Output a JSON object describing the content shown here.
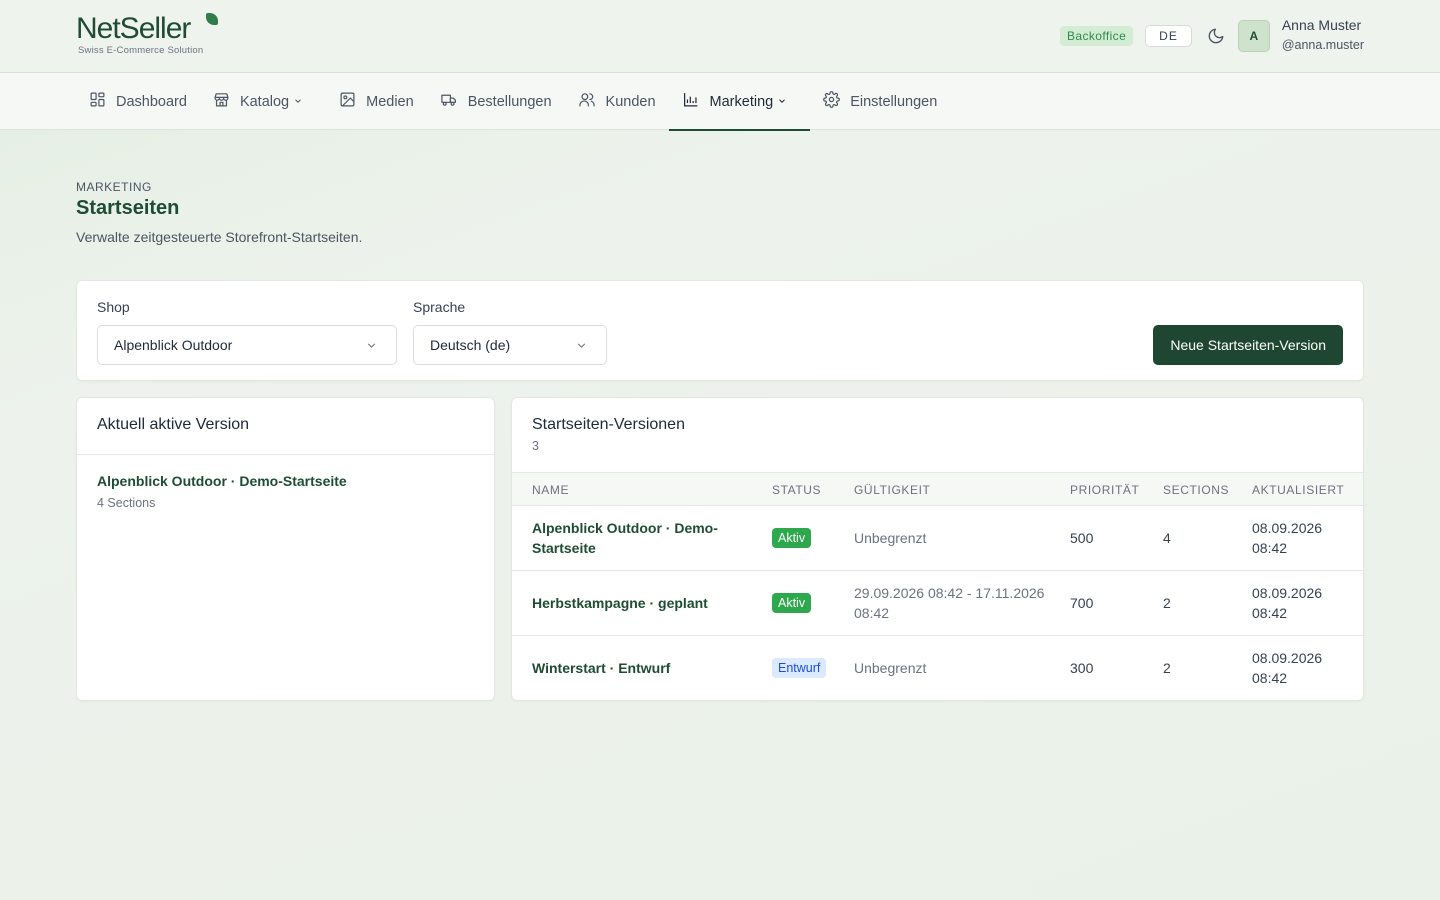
{
  "brand": {
    "name": "NetSeller",
    "tagline": "Swiss E-Commerce Solution"
  },
  "header": {
    "badge": "Backoffice",
    "language": "DE",
    "theme_toggle_icon": "moon-icon",
    "user": {
      "initial": "A",
      "name": "Anna Muster",
      "handle": "@anna.muster"
    }
  },
  "nav": {
    "items": [
      {
        "label": "Dashboard",
        "icon": "dashboard-icon",
        "dropdown": false,
        "active": false
      },
      {
        "label": "Katalog",
        "icon": "store-icon",
        "dropdown": true,
        "active": false
      },
      {
        "label": "Medien",
        "icon": "image-icon",
        "dropdown": false,
        "active": false
      },
      {
        "label": "Bestellungen",
        "icon": "truck-icon",
        "dropdown": false,
        "active": false
      },
      {
        "label": "Kunden",
        "icon": "users-icon",
        "dropdown": false,
        "active": false
      },
      {
        "label": "Marketing",
        "icon": "chart-icon",
        "dropdown": true,
        "active": true
      },
      {
        "label": "Einstellungen",
        "icon": "gear-icon",
        "dropdown": false,
        "active": false
      }
    ]
  },
  "page": {
    "eyebrow": "MARKETING",
    "title": "Startseiten",
    "subtitle": "Verwalte zeitgesteuerte Storefront-Startseiten."
  },
  "filters": {
    "shop_label": "Shop",
    "shop_value": "Alpenblick Outdoor",
    "language_label": "Sprache",
    "language_value": "Deutsch (de)",
    "new_button": "Neue Startseiten-Version"
  },
  "active_version": {
    "heading": "Aktuell aktive Version",
    "name": "Alpenblick Outdoor · Demo-Startseite",
    "meta": "4 Sections"
  },
  "versions": {
    "heading": "Startseiten-Versionen",
    "count": "3",
    "columns": [
      "NAME",
      "STATUS",
      "GÜLTIGKEIT",
      "PRIORITÄT",
      "SECTIONS",
      "AKTUALISIERT"
    ],
    "rows": [
      {
        "name": "Alpenblick Outdoor · Demo-Startseite",
        "status": "Aktiv",
        "status_kind": "aktiv",
        "valid": "Unbegrenzt",
        "priority": "500",
        "sections": "4",
        "updated": "08.09.2026 08:42"
      },
      {
        "name": "Herbstkampagne · geplant",
        "status": "Aktiv",
        "status_kind": "aktiv",
        "valid": "29.09.2026 08:42 - 17.11.2026 08:42",
        "priority": "700",
        "sections": "2",
        "updated": "08.09.2026 08:42"
      },
      {
        "name": "Winterstart · Entwurf",
        "status": "Entwurf",
        "status_kind": "entwurf",
        "valid": "Unbegrenzt",
        "priority": "300",
        "sections": "2",
        "updated": "08.09.2026 08:42"
      }
    ]
  },
  "colors": {
    "brand": "#1e4d33",
    "primary_button": "#1e4630",
    "status_active": "#2ea84d",
    "status_draft": "#dbeafe"
  }
}
